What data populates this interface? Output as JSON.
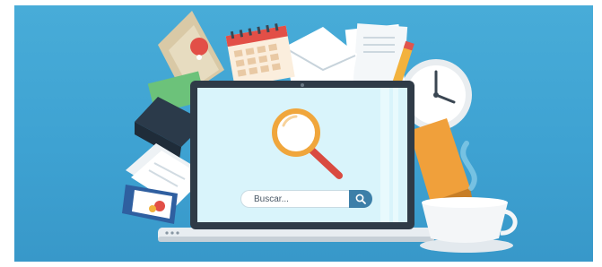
{
  "search": {
    "placeholder": "Buscar...",
    "icon": "magnifier-icon"
  },
  "colors": {
    "background": "#3ea2d2",
    "laptop_frame": "#2f3b47",
    "screen": "#d9f4fb",
    "magnifier_rim": "#f0a63c",
    "magnifier_handle": "#d94a40",
    "search_button": "#3d7fa8"
  }
}
